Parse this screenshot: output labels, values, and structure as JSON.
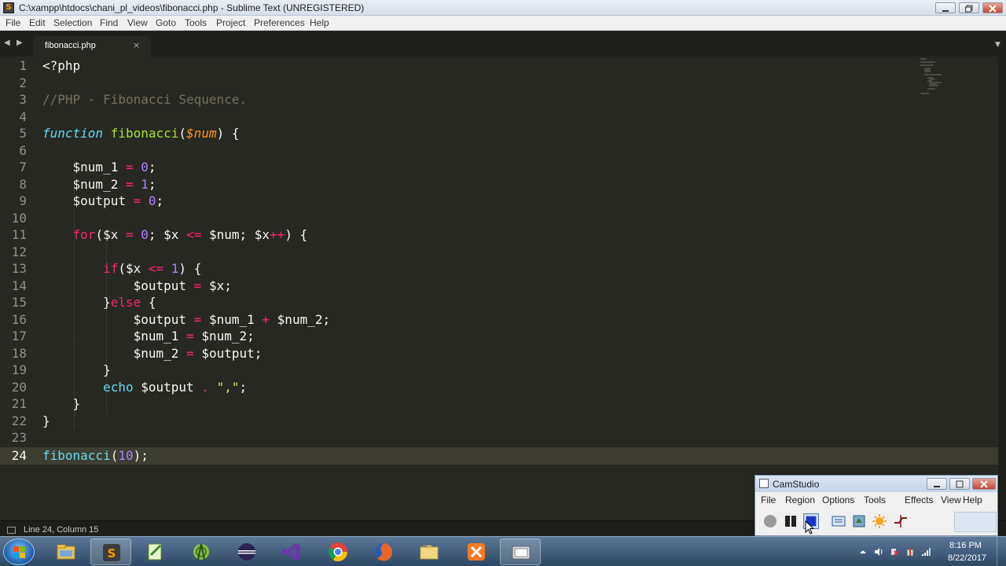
{
  "window": {
    "title": "C:\\xampp\\htdocs\\chani_pl_videos\\fibonacci.php - Sublime Text (UNREGISTERED)",
    "minimize": "▭",
    "maximize": "❐",
    "close": "✕"
  },
  "menu": [
    "File",
    "Edit",
    "Selection",
    "Find",
    "View",
    "Goto",
    "Tools",
    "Project",
    "Preferences",
    "Help"
  ],
  "tab": {
    "label": "fibonacci.php",
    "close": "×"
  },
  "editor": {
    "line_numbers": [
      "1",
      "2",
      "3",
      "4",
      "5",
      "6",
      "7",
      "8",
      "9",
      "10",
      "11",
      "12",
      "13",
      "14",
      "15",
      "16",
      "17",
      "18",
      "19",
      "20",
      "21",
      "22",
      "23",
      "24"
    ],
    "current_line": "24",
    "code": {
      "l1": "<?php",
      "l3": "//PHP - Fibonacci Sequence.",
      "l5_kw": "function",
      "l5_fn": "fibonacci",
      "l5_p": "$num",
      "l7_var": "$num_1",
      "l7_val": "0",
      "l8_var": "$num_2",
      "l8_val": "1",
      "l9_var": "$output",
      "l9_val": "0",
      "l11_kw": "for",
      "l11_a": "$x",
      "l11_z": "0",
      "l11_b": "$x",
      "l11_c": "$num",
      "l11_d": "$x",
      "l13_kw": "if",
      "l13_a": "$x",
      "l13_n": "1",
      "l14_a": "$output",
      "l14_b": "$x",
      "l15_kw": "else",
      "l16_a": "$output",
      "l16_b": "$num_1",
      "l16_c": "$num_2",
      "l17_a": "$num_1",
      "l17_b": "$num_2",
      "l18_a": "$num_2",
      "l18_b": "$output",
      "l20_kw": "echo",
      "l20_a": "$output",
      "l20_s": "\",\"",
      "l24_fn": "fibonacci",
      "l24_n": "10"
    }
  },
  "status": {
    "text": "Line 24, Column 15"
  },
  "camstudio": {
    "title": "CamStudio",
    "menu": [
      "File",
      "Region",
      "Options",
      "Tools",
      "Effects",
      "View",
      "Help"
    ],
    "buttons": [
      "record-icon",
      "pause-icon",
      "stop-icon",
      "region-icon",
      "options-icon",
      "effects-icon",
      "autopan-icon"
    ]
  },
  "taskbar": {
    "apps": [
      "windows-explorer",
      "sublime-text",
      "notepad-plus-plus",
      "android-studio",
      "eclipse",
      "visual-studio",
      "google-chrome",
      "firefox",
      "folder",
      "xampp",
      "camstudio"
    ],
    "time": "8:16 PM",
    "date": "8/22/2017"
  },
  "colors": {
    "editor_bg": "#272822",
    "keyword": "#66d9ef",
    "function": "#a6e22e",
    "operator": "#f92672",
    "number": "#ae81ff",
    "string": "#e6db74",
    "comment": "#75715e",
    "param": "#fd971f"
  }
}
